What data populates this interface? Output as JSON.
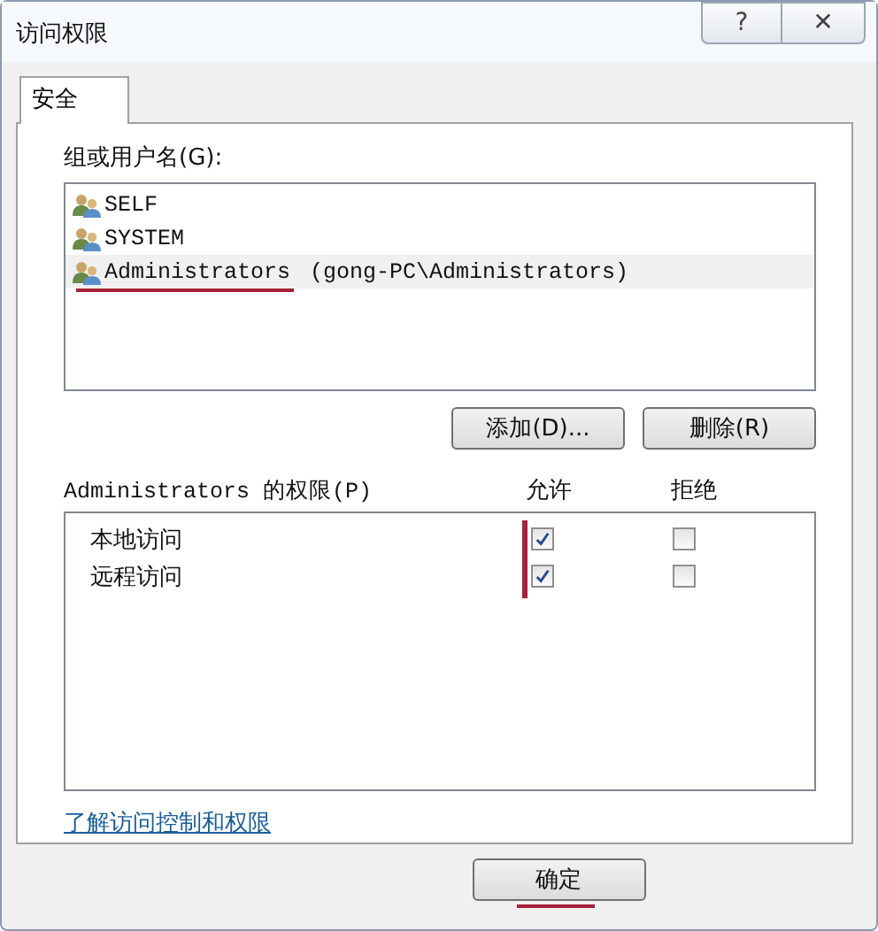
{
  "window": {
    "title": "访问权限"
  },
  "title_buttons": [
    {
      "kind": "help",
      "label": "?"
    },
    {
      "kind": "close",
      "label": "✕"
    }
  ],
  "tabs": [
    {
      "label": "安全",
      "selected": true
    }
  ],
  "users": {
    "label": "组或用户名(G):",
    "items": [
      {
        "name": "SELF",
        "selected": false,
        "annotated": false
      },
      {
        "name": "SYSTEM",
        "selected": false,
        "annotated": false
      },
      {
        "name": "Administrators",
        "detail": "(gong-PC\\Administrators)",
        "selected": true,
        "annotated": true
      }
    ]
  },
  "user_buttons": [
    "添加(D)...",
    "删除(R)"
  ],
  "permissions": {
    "label": "Administrators 的权限(P)",
    "columns": [
      "允许",
      "拒绝"
    ],
    "allow_annotated": true,
    "rows": [
      {
        "name": "本地访问",
        "allow": true,
        "deny": false
      },
      {
        "name": "远程访问",
        "allow": true,
        "deny": false
      }
    ]
  },
  "link": "了解访问控制和权限",
  "ok_button": {
    "label": "确定",
    "annotated": true
  }
}
